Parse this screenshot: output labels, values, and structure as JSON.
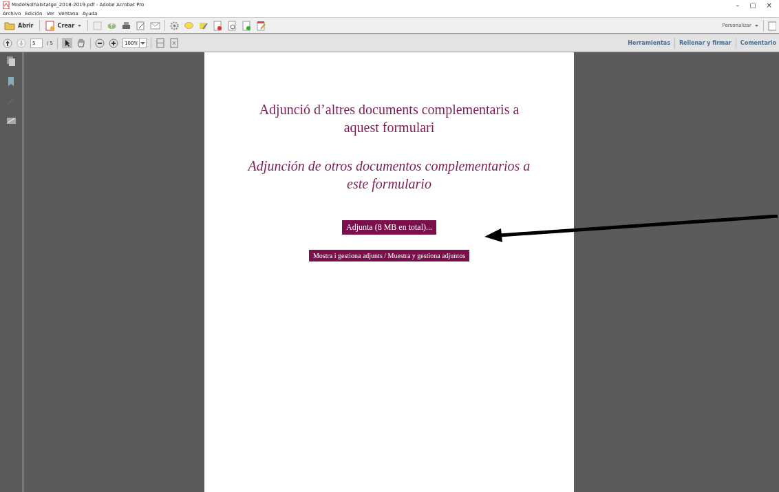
{
  "window": {
    "title": "ModelSolhabitatge_2018-2019.pdf - Adobe Acrobat Pro",
    "controls": [
      "–",
      "▢",
      "×"
    ]
  },
  "menu": [
    "Archivo",
    "Edición",
    "Ver",
    "Ventana",
    "Ayuda"
  ],
  "toolbar": {
    "open": "Abrir",
    "create": "Crear",
    "customize": "Personalizar"
  },
  "navigation": {
    "page": "5",
    "page_total": "/ 5",
    "zoom": "100%"
  },
  "panes": [
    {
      "label": "Herramientas"
    },
    {
      "label": "Rellenar y firmar"
    },
    {
      "label": "Comentario"
    }
  ],
  "document": {
    "heading": "Adjunció d’altres documents complementaris a aquest formulari",
    "heading_es": "Adjunción de otros documentos complementarios a este formulario",
    "buttons": [
      "Adjunta (8 MB en total)...",
      "Mostra i gestiona adjunts / Muestra y gestiona adjuntos"
    ]
  }
}
